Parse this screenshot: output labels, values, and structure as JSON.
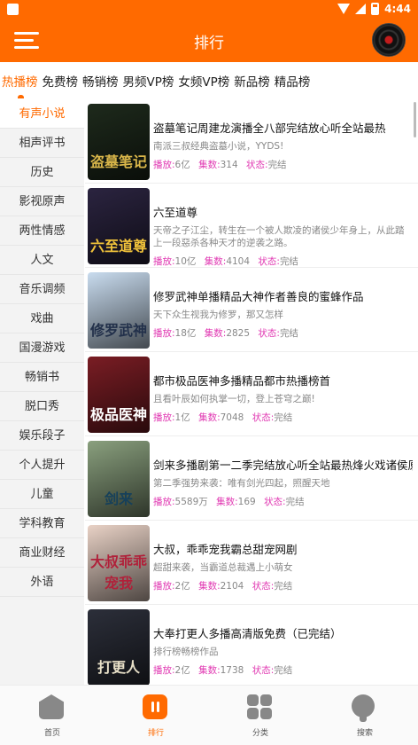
{
  "status": {
    "time": "4:44"
  },
  "header": {
    "title": "排行"
  },
  "tabs": [
    "热播榜",
    "免费榜",
    "畅销榜",
    "男频VP榜",
    "女频VP榜",
    "新品榜",
    "精品榜"
  ],
  "sidebar": [
    "有声小说",
    "相声评书",
    "历史",
    "影视原声",
    "两性情感",
    "人文",
    "音乐调频",
    "戏曲",
    "国漫游戏",
    "畅销书",
    "脱口秀",
    "娱乐段子",
    "个人提升",
    "儿童",
    "学科教育",
    "商业财经",
    "外语"
  ],
  "labels": {
    "plays": "播放:",
    "episodes": "集数:",
    "state": "状态:"
  },
  "books": [
    {
      "title": "盗墓笔记周建龙演播全八部完结放心听全站最热",
      "desc": "南派三叔经典盗墓小说，YYDS!",
      "plays": "6亿",
      "episodes": "314",
      "state": "完结",
      "cover_text": "盗墓笔记",
      "bg": "#1e2a1c",
      "fg": "#d9b64a"
    },
    {
      "title": "六至道尊",
      "desc": "天帝之子江尘，转生在一个被人欺凌的诸侯少年身上，从此踏上一段惡杀各种天才的逆袭之路。",
      "plays": "10亿",
      "episodes": "4104",
      "state": "完结",
      "cover_text": "六至道尊",
      "bg": "#2b2440",
      "fg": "#f0c23a"
    },
    {
      "title": "修罗武神单播精品大神作者善良的蜜蜂作品",
      "desc": "天下众生视我为修罗，那又怎样",
      "plays": "18亿",
      "episodes": "2825",
      "state": "完结",
      "cover_text": "修罗武神",
      "bg": "#c9dcef",
      "fg": "#22304a"
    },
    {
      "title": "都市极品医神多播精品都市热播榜首",
      "desc": "且看叶辰如何执掌一切，登上苍穹之巅!",
      "plays": "1亿",
      "episodes": "7048",
      "state": "完结",
      "cover_text": "极品医神",
      "bg": "#7a1d24",
      "fg": "#ffffff"
    },
    {
      "title": "剑来多播剧第一二季完结放心听全站最热烽火戏诸侯原著",
      "desc": "第二季强势来袭：唯有剑光四起，照醒天地",
      "plays": "5589万",
      "episodes": "169",
      "state": "完结",
      "cover_text": "剑来",
      "bg": "#8aa07e",
      "fg": "#16405a"
    },
    {
      "title": "大叔，乖乖宠我霸总甜宠网剧",
      "desc": "超甜来袭，当霸道总裁遇上小萌女",
      "plays": "2亿",
      "episodes": "2104",
      "state": "完结",
      "cover_text": "大叔乖乖宠我",
      "bg": "#e9d2c6",
      "fg": "#b0213a"
    },
    {
      "title": "大奉打更人多播高清版免费（已完结）",
      "desc": "排行榜畅榜作品",
      "plays": "2亿",
      "episodes": "1738",
      "state": "完结",
      "cover_text": "打更人",
      "bg": "#2c2f3a",
      "fg": "#e8e0c8"
    }
  ],
  "nav": [
    "首页",
    "排行",
    "分类",
    "搜索"
  ],
  "colors": {
    "accent": "#ff6a00",
    "meta_key": "#e13bb3"
  }
}
